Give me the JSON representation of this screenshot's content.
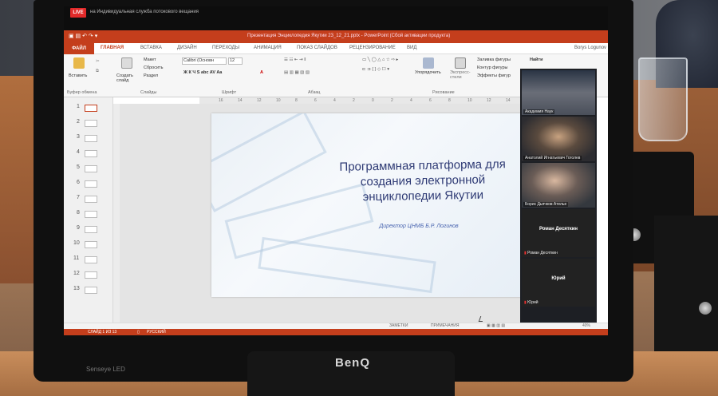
{
  "stream": {
    "live_label": "LIVE",
    "title": "на Индивидуальная служба потокового вещания"
  },
  "powerpoint": {
    "window_title": "Презентация Энциклопедия Якутии 23_12_21.pptx - PowerPoint (Сбой активации продукта)",
    "user": "Borys Logunov",
    "menu": {
      "file": "ФАЙЛ",
      "items": [
        "ГЛАВНАЯ",
        "ВСТАВКА",
        "ДИЗАЙН",
        "ПЕРЕХОДЫ",
        "АНИМАЦИЯ",
        "ПОКАЗ СЛАЙДОВ",
        "РЕЦЕНЗИРОВАНИЕ",
        "ВИД"
      ]
    },
    "ribbon": {
      "paste": "Вставить",
      "clipboard_group": "Буфер обмена",
      "new_slide": "Создать слайд",
      "layout": "Макет",
      "reset": "Сбросить",
      "section": "Раздел",
      "slides_group": "Слайды",
      "font_name": "Calibri (Основн",
      "font_size": "12",
      "font_group": "Шрифт",
      "paragraph_group": "Абзац",
      "arrange": "Упорядочить",
      "quick_styles": "Экспресс-стили",
      "shape_fill": "Заливка фигуры",
      "shape_outline": "Контур фигуры",
      "shape_effects": "Эффекты фигур",
      "drawing_group": "Рисование",
      "find": "Найти"
    },
    "ruler_ticks": [
      "16",
      "14",
      "12",
      "10",
      "8",
      "6",
      "4",
      "2",
      "0",
      "2",
      "4",
      "6",
      "8",
      "10",
      "12",
      "14",
      "16"
    ],
    "slide_numbers": [
      "1",
      "2",
      "3",
      "4",
      "5",
      "6",
      "7",
      "8",
      "9",
      "10",
      "11",
      "12",
      "13"
    ],
    "slide": {
      "title": "Программная платформа для создания электронной энциклопедии Якутии",
      "subtitle": "Директор ЦНМБ Б.Р. Логинов"
    },
    "participants": {
      "tile1_name": "Академия Наук",
      "tile2_name": "Анатолий Игнатьевич Гоголев",
      "tile3_name": "Борис Дьячков  Ателье",
      "tile4_center": "Роман Десяткин",
      "tile4_corner": "Роман Десяткин",
      "tile5_center": "Юрий",
      "tile5_corner": "Юрий"
    },
    "notes": {
      "notes_label": "ЗАМЕТКИ",
      "comments_label": "ПРИМЕЧАНИЯ",
      "zoom": "40%"
    },
    "status": {
      "slide_counter": "СЛАЙД 1 ИЗ 13",
      "language": "РУССКИЙ"
    }
  },
  "monitor": {
    "brand": "BenQ",
    "model_label": "Senseye LED"
  },
  "colors": {
    "accent": "#c43e1c",
    "slide_title": "#2f3b75"
  }
}
